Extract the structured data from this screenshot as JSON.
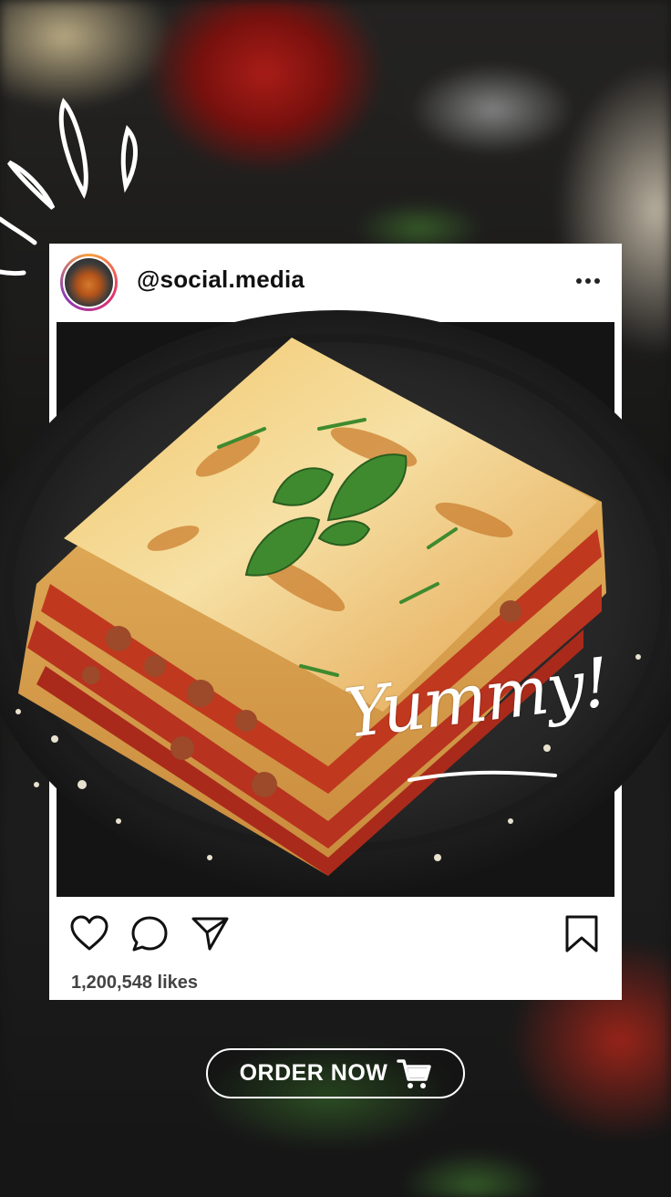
{
  "post": {
    "username": "@social.media",
    "likes": "1,200,548 likes",
    "overlay_text": "Yummy!"
  },
  "cta": {
    "label": "ORDER NOW"
  },
  "icons": {
    "avatar": "avatar",
    "more": "more-options-icon",
    "like": "heart-icon",
    "comment": "comment-icon",
    "share": "send-icon",
    "save": "bookmark-icon",
    "cart": "shopping-cart-icon"
  },
  "colors": {
    "card": "#ffffff",
    "text": "#111111",
    "likes_text": "#444444",
    "cta_border": "#ffffff"
  }
}
